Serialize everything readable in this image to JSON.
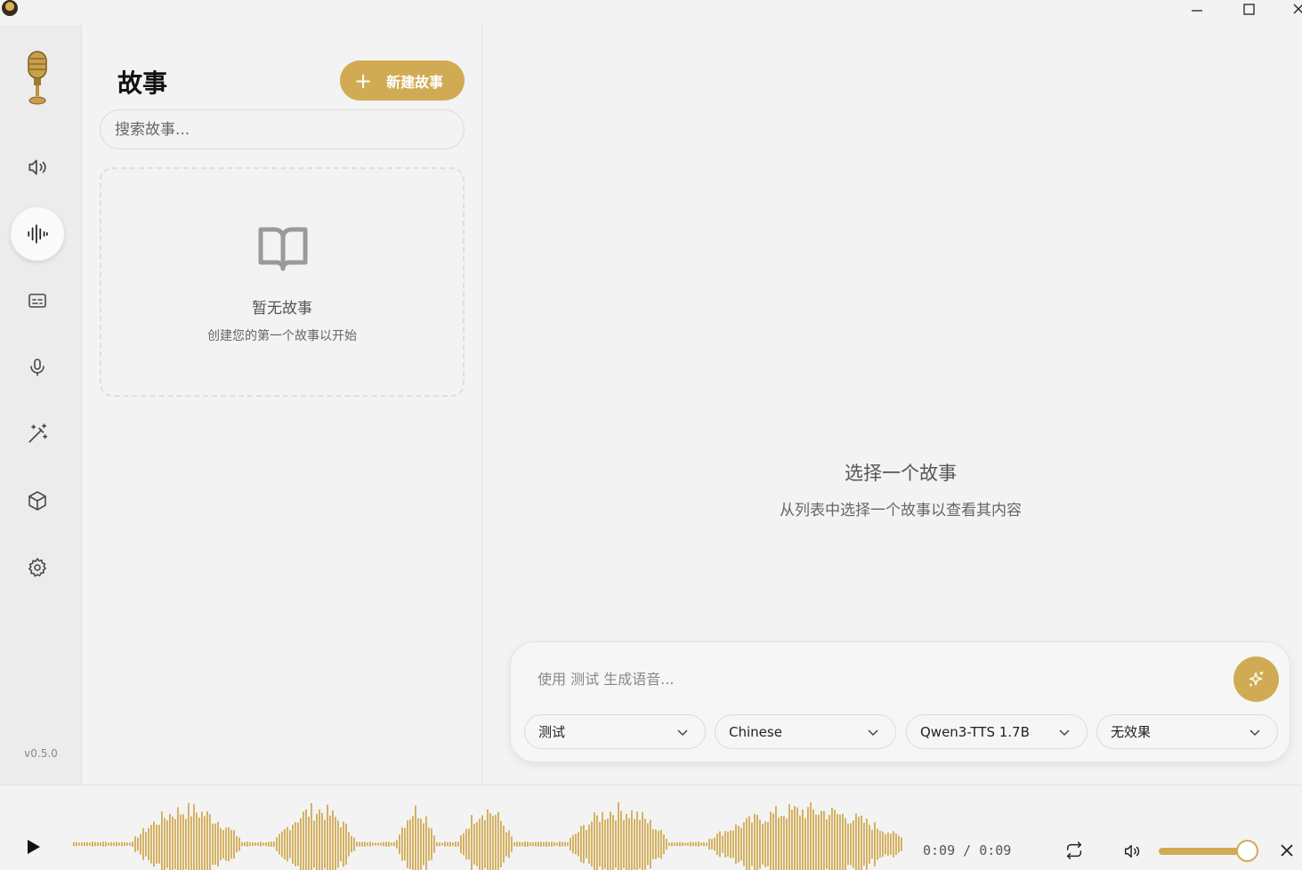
{
  "window": {
    "minimize_icon": "minimize-icon",
    "maximize_icon": "maximize-icon",
    "close_icon": "close-icon"
  },
  "sidebar": {
    "logo": "microphone-logo",
    "items": [
      {
        "name": "speaker",
        "icon": "speaker-icon",
        "active": false
      },
      {
        "name": "voices",
        "icon": "waveform-icon",
        "active": true
      },
      {
        "name": "captions",
        "icon": "captions-icon",
        "active": false
      },
      {
        "name": "record",
        "icon": "microphone-icon",
        "active": false
      },
      {
        "name": "effects",
        "icon": "magic-wand-icon",
        "active": false
      },
      {
        "name": "models",
        "icon": "box-icon",
        "active": false
      },
      {
        "name": "settings",
        "icon": "gear-icon",
        "active": false
      }
    ],
    "version": "v0.5.0"
  },
  "stories": {
    "title": "故事",
    "new_button": "新建故事",
    "search_placeholder": "搜索故事...",
    "empty_title": "暂无故事",
    "empty_subtitle": "创建您的第一个故事以开始"
  },
  "main": {
    "select_title": "选择一个故事",
    "select_subtitle": "从列表中选择一个故事以查看其内容"
  },
  "generator": {
    "placeholder": "使用 测试 生成语音...",
    "voice": "测试",
    "language": "Chinese",
    "model": "Qwen3-TTS 1.7B",
    "effect": "无效果"
  },
  "player": {
    "time": "0:09 / 0:09",
    "volume": 1.0,
    "accent": "#d1ab53"
  }
}
